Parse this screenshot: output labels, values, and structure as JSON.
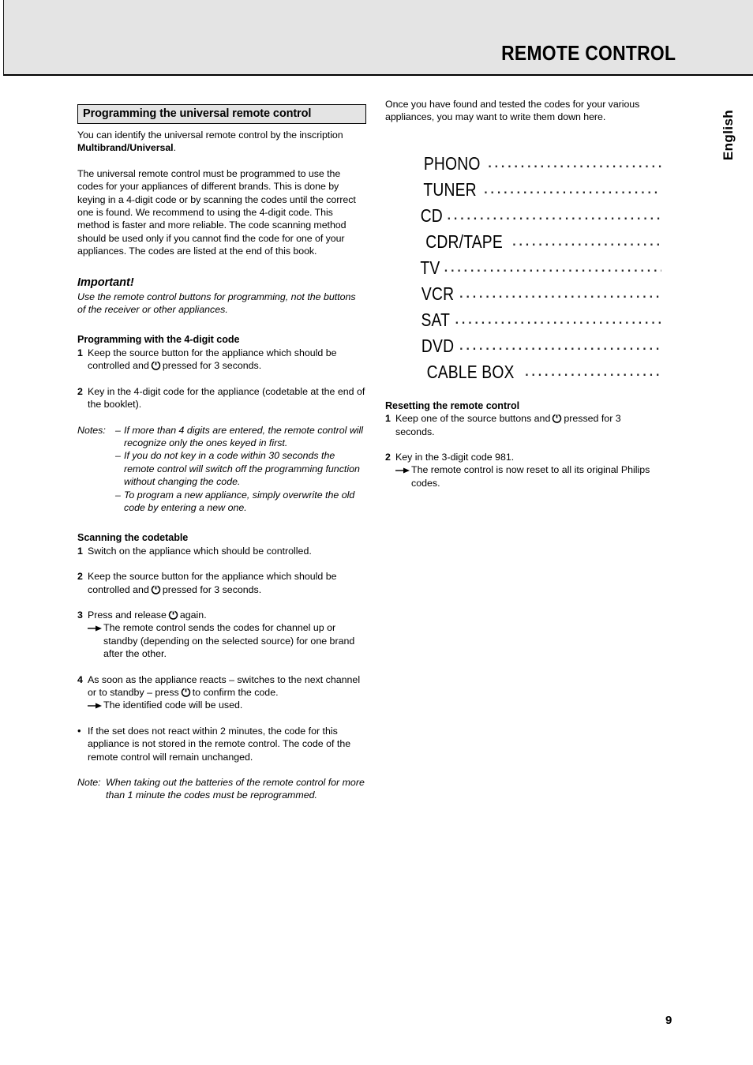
{
  "header": {
    "title": "REMOTE CONTROL"
  },
  "language_tab": {
    "label": "English"
  },
  "left_column": {
    "section_heading": "Programming the universal remote control",
    "intro_p1_a": "You can identify the universal remote control by the inscription ",
    "intro_p1_bold": "Multibrand/Universal",
    "intro_p1_b": ".",
    "intro_p2": "The universal remote control must be programmed to use the codes for your appliances of different brands. This is done by keying in a 4-digit code or by scanning the codes until the correct one is found. We recommend to using the 4-digit code. This method is faster and more reliable. The code scanning method should be used only if you cannot find the code for one of your appliances. The codes are listed at the end of this book.",
    "important_heading": "Important!",
    "important_text": "Use the remote control buttons for programming, not the buttons of the receiver or other appliances.",
    "four_digit_heading": "Programming with the 4-digit code",
    "four_digit_steps": [
      {
        "num": "1",
        "text_before": "Keep the source button for the appliance which should be controlled and",
        "icon": "power-icon",
        "text_after": "pressed for 3 seconds."
      },
      {
        "num": "2",
        "text_before": "Key in the 4-digit code for the appliance (codetable at the end of the booklet).",
        "icon": "",
        "text_after": ""
      }
    ],
    "notes_label": "Notes:",
    "notes_dash": "–",
    "notes": [
      "If more than 4 digits are entered, the remote control will recognize only the ones keyed in first.",
      "If you do not key in a code within 30 seconds the remote control will switch off the programming function without changing the code.",
      "To program a new appliance, simply overwrite the old code by entering a new one."
    ],
    "scanning_heading": "Scanning the codetable",
    "scanning_steps": [
      {
        "num": "1",
        "text_before": "Switch on the appliance which should be controlled.",
        "icon": "",
        "text_after": "",
        "result": ""
      },
      {
        "num": "2",
        "text_before": "Keep the source button for the appliance which should be controlled and",
        "icon": "power-icon",
        "text_after": "pressed for 3 seconds.",
        "result": ""
      },
      {
        "num": "3",
        "text_before": "Press and release",
        "icon": "power-icon",
        "text_after": "again.",
        "result": "The remote control sends the codes for channel up or standby (depending on the selected source) for one brand after the other."
      },
      {
        "num": "4",
        "text_before": "As soon as the appliance reacts – switches to the next channel or to standby – press",
        "icon": "power-icon",
        "text_after": "to confirm the code.",
        "result": "The identified code will be used."
      }
    ],
    "bullet_char": "•",
    "bullet_text": "If the set does not react within 2 minutes, the code for this appliance is not stored in the remote control. The code of the remote control will remain unchanged.",
    "final_note_label": "Note:",
    "final_note_text": "When taking out the batteries of the remote control for more than 1 minute the codes must be reprogrammed."
  },
  "right_column": {
    "intro": "Once you have found and tested the codes for your various appliances, you may want to write them down here.",
    "appliances": [
      "PHONO",
      "TUNER",
      "CD",
      "CDR/TAPE",
      "TV",
      "VCR",
      "SAT",
      "DVD",
      "CABLE BOX"
    ],
    "leader_dots": "..................................................................",
    "reset_heading": "Resetting the remote control",
    "reset_steps": [
      {
        "num": "1",
        "text_before": "Keep one of the source buttons and",
        "icon": "power-icon",
        "text_after": "pressed for 3 seconds.",
        "result": ""
      },
      {
        "num": "2",
        "text_before": "Key in the 3-digit code 981.",
        "icon": "",
        "text_after": "",
        "result": "The remote control is now reset to all its original Philips codes."
      }
    ]
  },
  "footer": {
    "page_number": "9"
  },
  "colors": {
    "header_band": "#e4e4e4",
    "section_box": "#e4e4e4",
    "text": "#000000",
    "rule": "#000000"
  }
}
